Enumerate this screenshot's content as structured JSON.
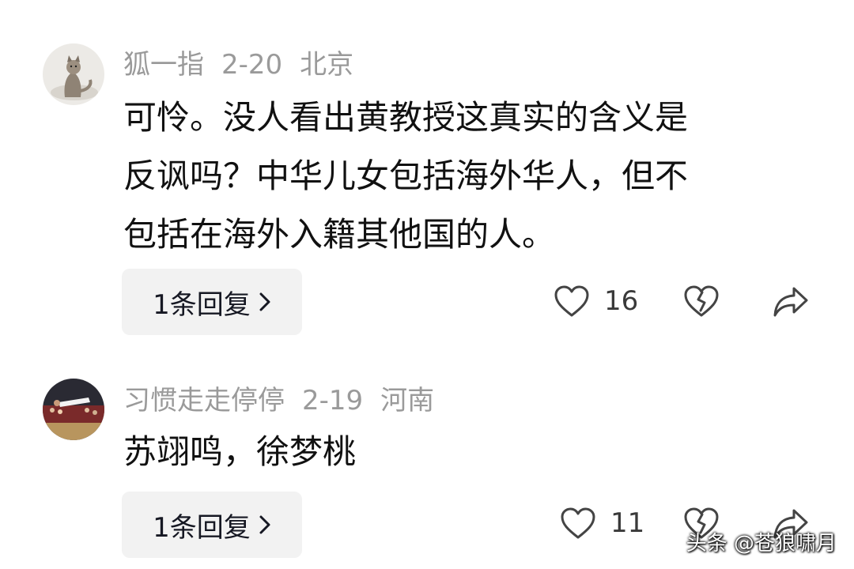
{
  "comments": [
    {
      "username": "狐一指",
      "date": "2-20",
      "location": "北京",
      "text_lines": [
        "可怜。没人看出黄教授这真实的含义是",
        "反讽吗？中华儿女包括海外华人，但不",
        "包括在海外入籍其他国的人。"
      ],
      "reply_label": "1条回复",
      "like_count": "16",
      "avatar_icon": "cat-avatar"
    },
    {
      "username": "习惯走走停停",
      "date": "2-19",
      "location": "河南",
      "text_lines": [
        "苏翊鸣，徐梦桃"
      ],
      "reply_label": "1条回复",
      "like_count": "11",
      "avatar_icon": "basketball-avatar"
    }
  ],
  "icons": {
    "like": "heart-outline-icon",
    "dislike": "broken-heart-icon",
    "share": "share-arrow-icon",
    "chevron": "chevron-right-icon"
  },
  "watermark": "头条 @苍狼啸月"
}
